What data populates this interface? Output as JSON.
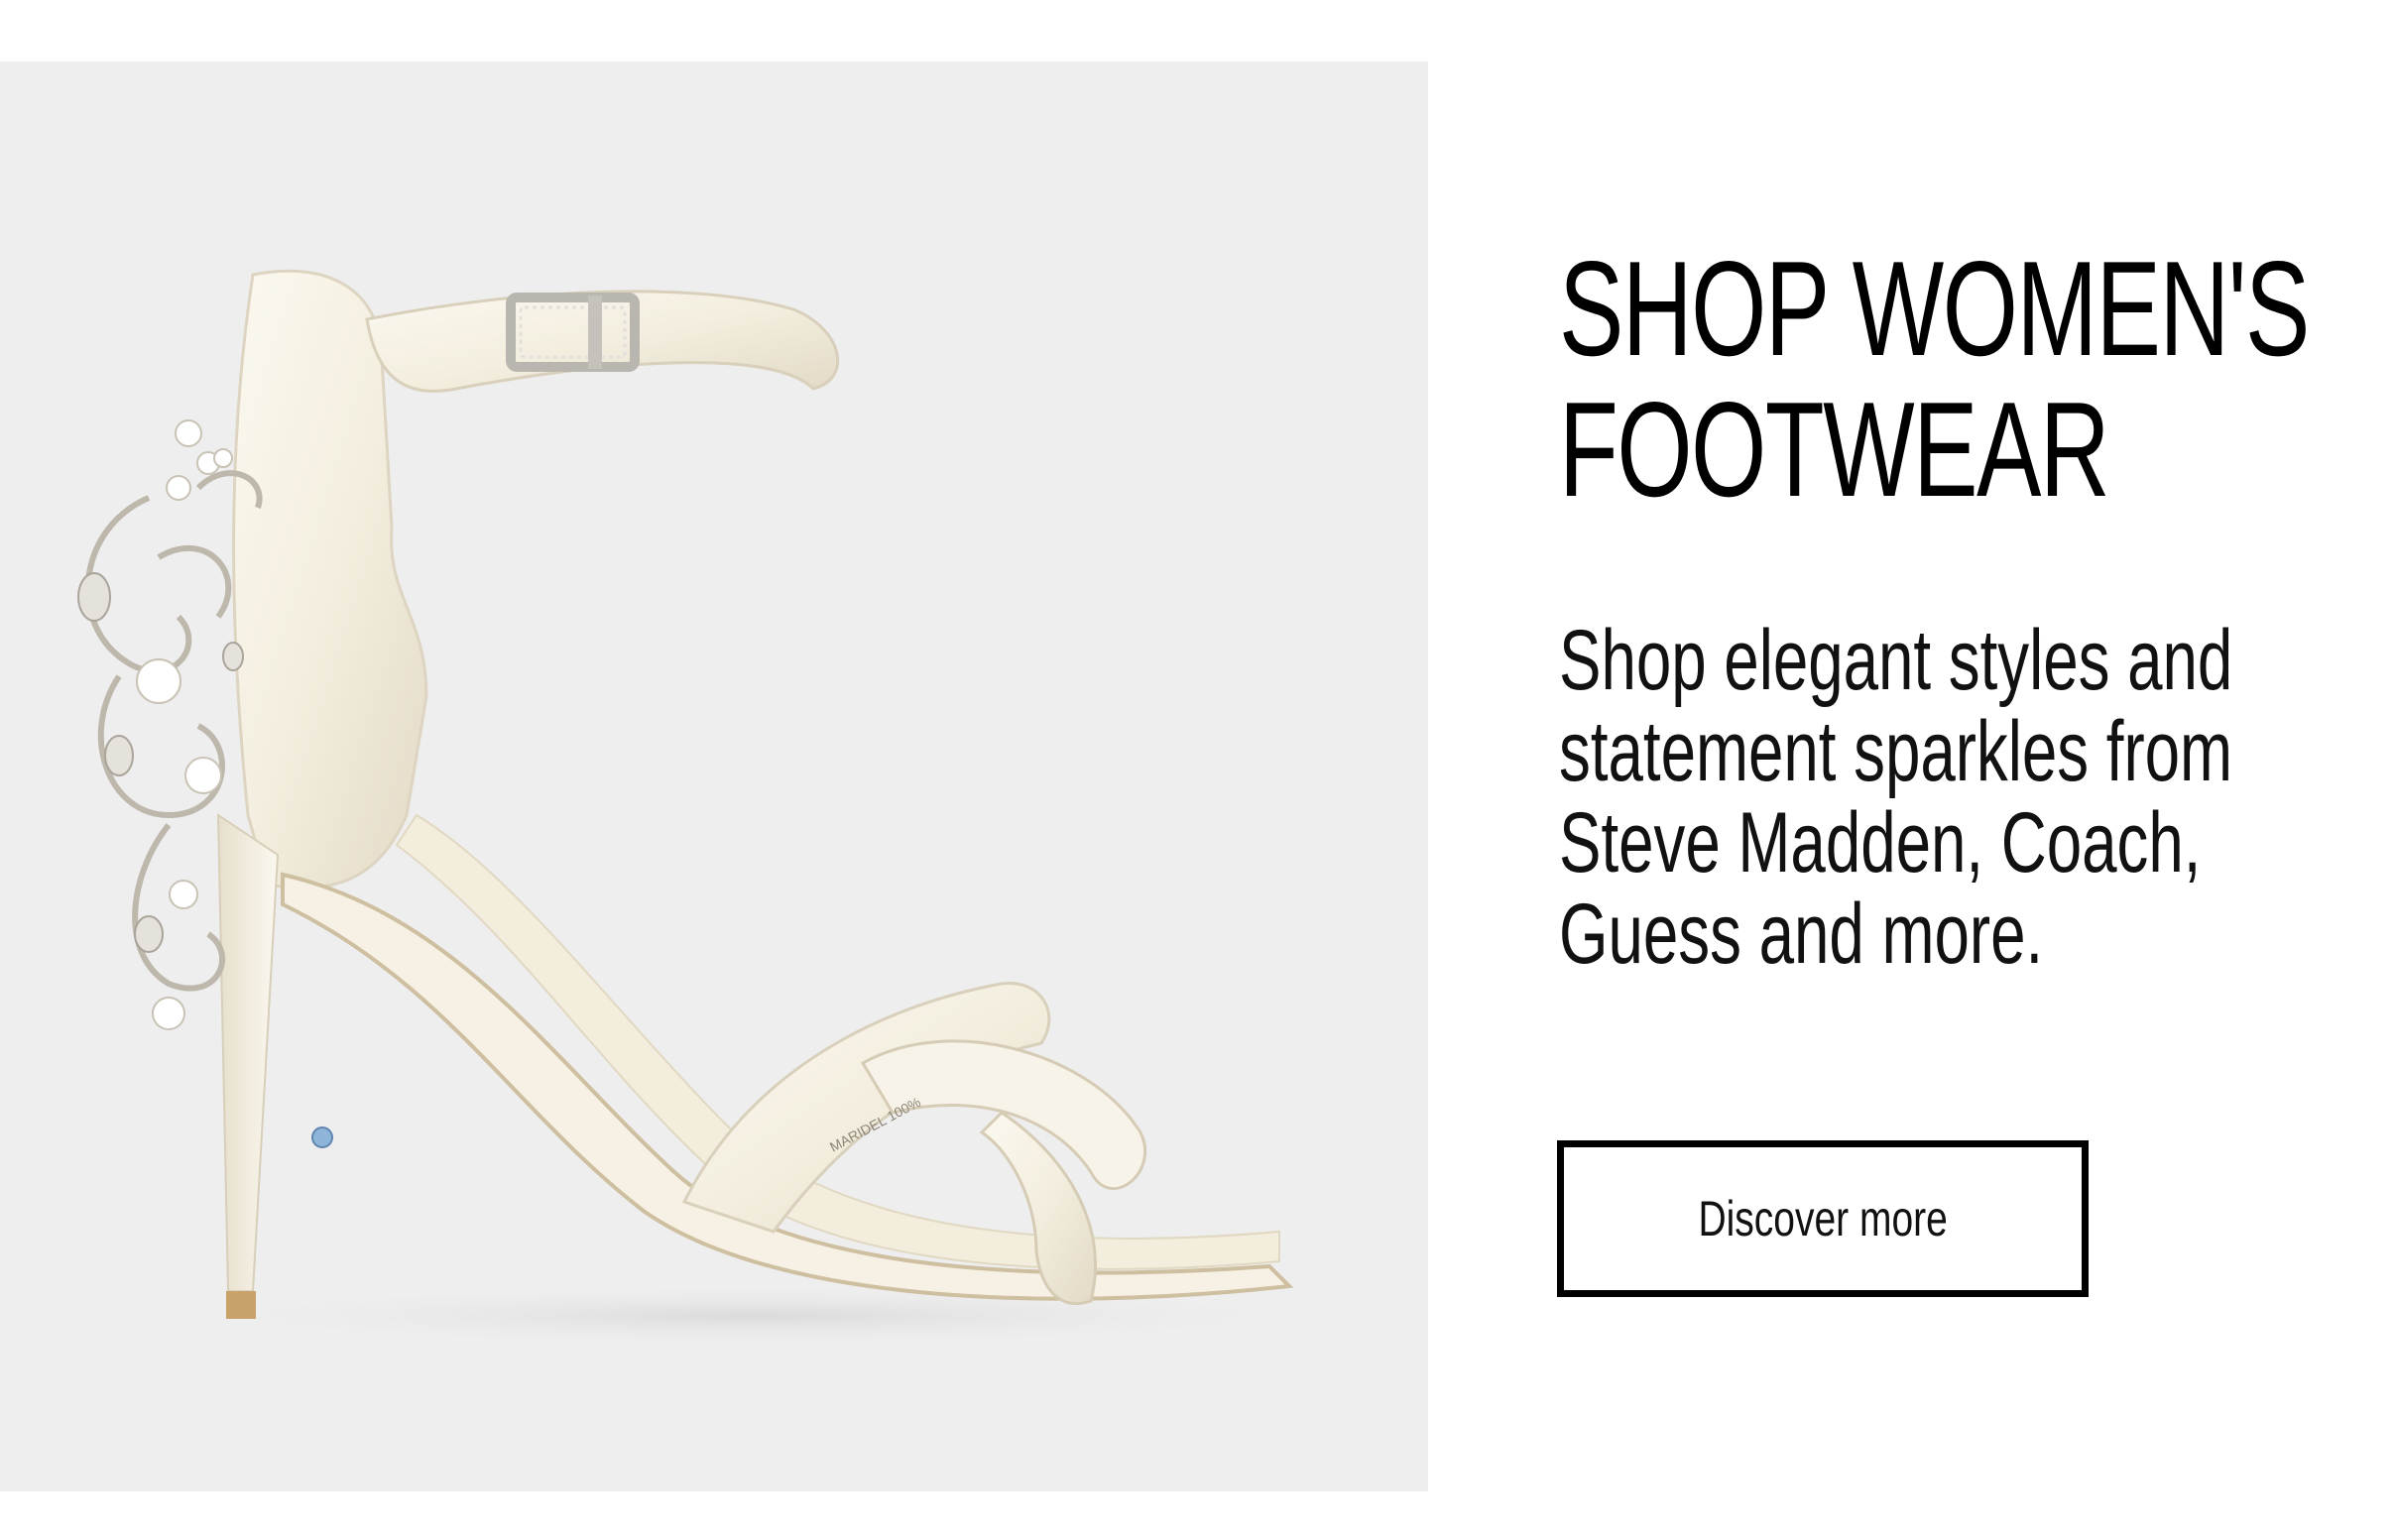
{
  "hero": {
    "image_alt": "Ivory satin ankle-strap stiletto sandal with jeweled heel embellishment",
    "background_color": "#eeeeee"
  },
  "promo": {
    "headline": "SHOP WOMEN'S\nFOOTWEAR",
    "body": "Shop elegant styles and statement sparkles from Steve Madden, Coach, Guess and more.",
    "cta_label": "Discover more"
  },
  "colors": {
    "text": "#000000",
    "button_border": "#000000",
    "page_background": "#ffffff"
  }
}
